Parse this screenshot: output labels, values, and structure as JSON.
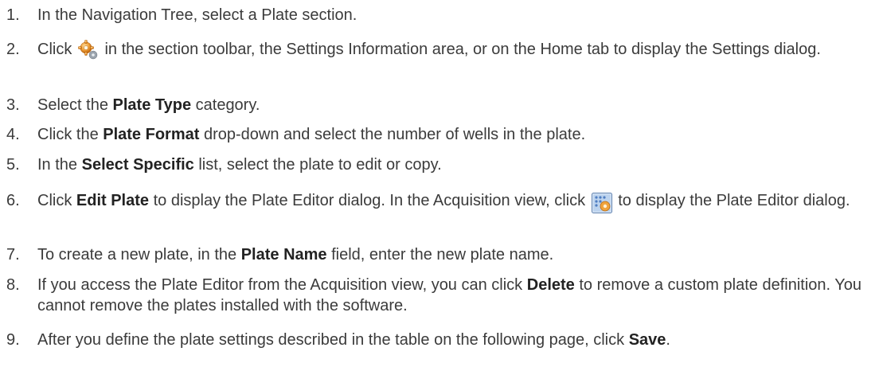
{
  "steps": [
    {
      "number": "1.",
      "parts": [
        "In the Navigation Tree, select a Plate section."
      ]
    },
    {
      "number": "2.",
      "pre": "Click ",
      "post": " in the section toolbar, the Settings Information area, or on the Home tab to display the Settings dialog.",
      "icon": "settings-gear-icon"
    },
    {
      "number": "3.",
      "pre": "Select the ",
      "bold": "Plate Type",
      "post": " category."
    },
    {
      "number": "4.",
      "pre": "Click the ",
      "bold": "Plate Format",
      "post": " drop-down and select the number of wells in the plate."
    },
    {
      "number": "5.",
      "pre": "In the ",
      "bold": "Select Specific",
      "post": " list, select the plate to edit or copy."
    },
    {
      "number": "6.",
      "pre": "Click ",
      "bold": "Edit Plate",
      "mid": " to display the Plate Editor dialog. In the Acquisition view, click ",
      "post": " to display the Plate Editor dialog.",
      "icon": "plate-editor-icon"
    },
    {
      "number": "7.",
      "pre": "To create a new plate, in the ",
      "bold": "Plate Name",
      "post": " field, enter the new plate name."
    },
    {
      "number": "8.",
      "pre": "If you access the Plate Editor from the Acquisition view, you can click ",
      "bold": "Delete",
      "post": " to remove a custom plate definition. You cannot remove the plates installed with the software."
    },
    {
      "number": "9.",
      "pre": "After you define the plate settings described in the table on the following page, click ",
      "bold": "Save",
      "post": "."
    }
  ]
}
